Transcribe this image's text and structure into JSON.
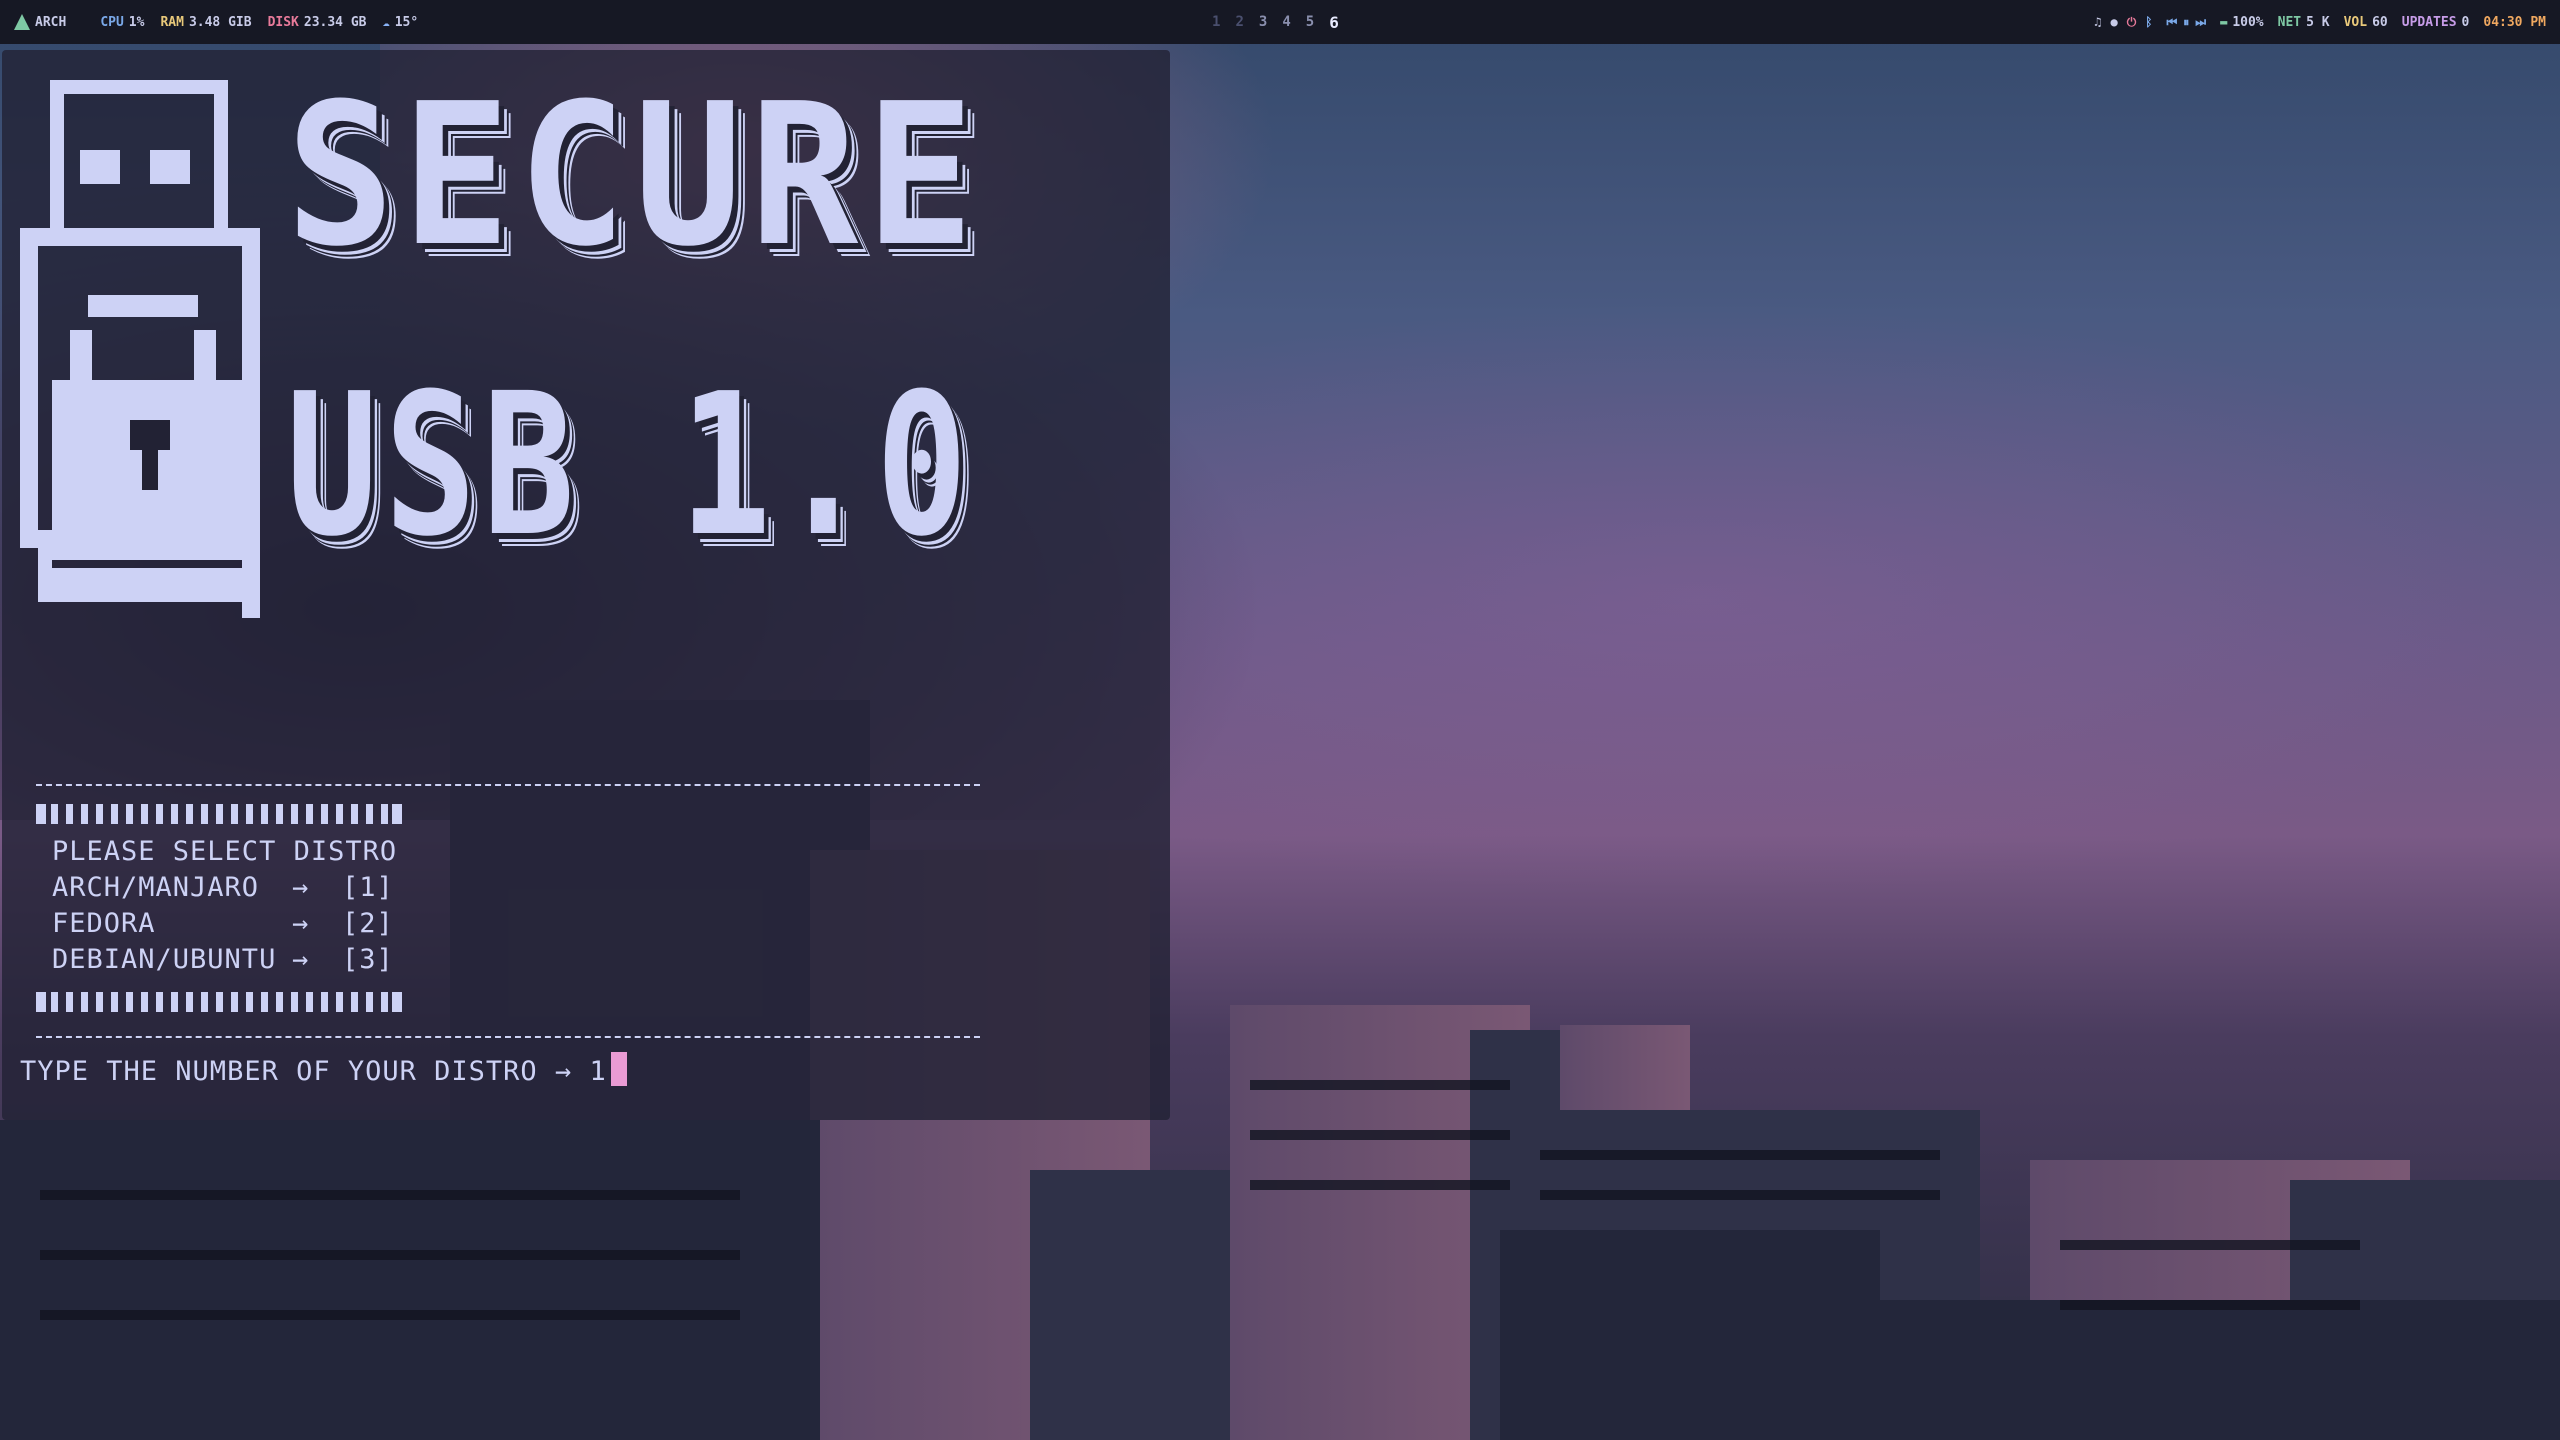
{
  "topbar": {
    "distro": "ARCH",
    "cpu_label": "CPU",
    "cpu_value": "1%",
    "ram_label": "RAM",
    "ram_value": "3.48 GIB",
    "disk_label": "DISK",
    "disk_value": "23.34 GB",
    "weather": "15°",
    "workspaces": [
      "1",
      "2",
      "3",
      "4",
      "5",
      "6"
    ],
    "active_workspace": "6",
    "battery": "100%",
    "net_label": "NET",
    "net_value": "5 K",
    "vol_label": "VOL",
    "vol_value": "60",
    "updates_label": "UPDATES",
    "updates_value": "0",
    "clock": "04:30 PM"
  },
  "colors": {
    "arch": "#7ec8a4",
    "cpu": "#7aa8e8",
    "ram": "#e8c87a",
    "disk": "#e87a9a",
    "weather": "#8ab4f8",
    "net": "#7ec8a4",
    "vol": "#e8c87a",
    "updates": "#c79ce8",
    "clock": "#f0a860",
    "battery": "#7ec8a4"
  },
  "terminal": {
    "banner_line1": "SECURE",
    "banner_line2": "USB 1.0",
    "menu_title": "PLEASE SELECT DISTRO",
    "options": [
      {
        "name": "ARCH/MANJARO",
        "arrow": "→",
        "key": "[1]"
      },
      {
        "name": "FEDORA",
        "arrow": "→",
        "key": "[2]"
      },
      {
        "name": "DEBIAN/UBUNTU",
        "arrow": "→",
        "key": "[3]"
      }
    ],
    "prompt": "TYPE THE NUMBER OF YOUR DISTRO → ",
    "input_value": "1"
  }
}
